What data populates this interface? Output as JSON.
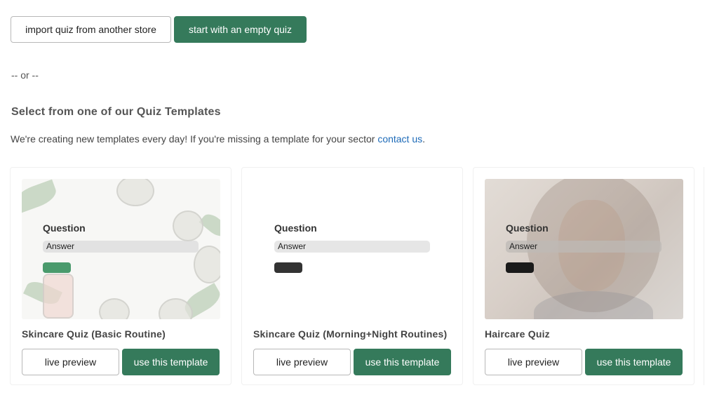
{
  "actions": {
    "import_label": "import quiz from another store",
    "empty_label": "start with an empty quiz"
  },
  "separator": "-- or --",
  "templates_section": {
    "title": "Select from one of our Quiz Templates",
    "description": "We're creating new templates every day! If you're missing a template for your sector ",
    "contact_link": "contact us",
    "description_end": "."
  },
  "cards": [
    {
      "title": "Skincare Quiz (Basic Routine)",
      "question": "Question",
      "answer": "Answer",
      "accent_color": "#4a9a6c",
      "live_preview": "live preview",
      "use_template": "use this template"
    },
    {
      "title": "Skincare Quiz (Morning+Night Routines)",
      "question": "Question",
      "answer": "Answer",
      "accent_color": "#333333",
      "live_preview": "live preview",
      "use_template": "use this template"
    },
    {
      "title": "Haircare Quiz",
      "question": "Question",
      "answer": "Answer",
      "accent_color": "#1a1a1a",
      "live_preview": "live preview",
      "use_template": "use this template"
    }
  ],
  "colors": {
    "primary": "#357a5b",
    "link": "#1e6bb8"
  }
}
